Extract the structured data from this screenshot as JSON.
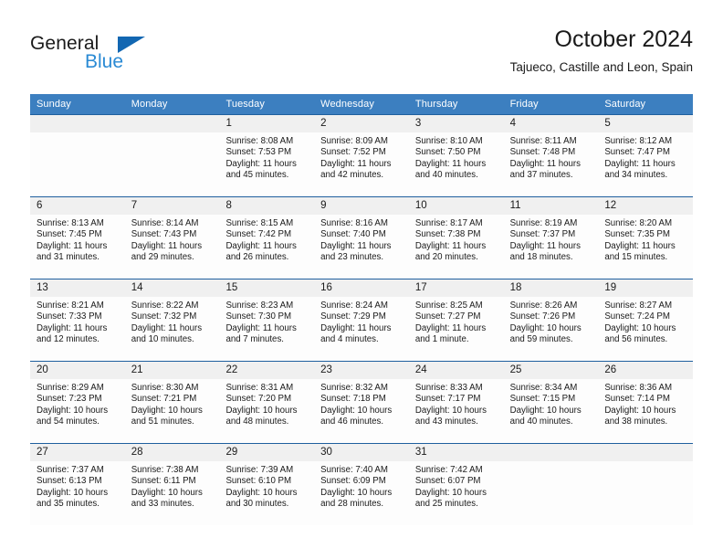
{
  "brand": {
    "name_part1": "General",
    "name_part2": "Blue",
    "accent_color": "#2a8ad4",
    "triangle_color": "#1267b2"
  },
  "header": {
    "title": "October 2024",
    "subtitle": "Tajueco, Castille and Leon, Spain"
  },
  "calendar": {
    "header_bg": "#3c7fc0",
    "header_text_color": "#ffffff",
    "daynum_bg": "#f0f0f0",
    "separator_color": "#1f5f9e",
    "weekdays": [
      "Sunday",
      "Monday",
      "Tuesday",
      "Wednesday",
      "Thursday",
      "Friday",
      "Saturday"
    ],
    "weeks": [
      [
        {
          "day": "",
          "sunrise": "",
          "sunset": "",
          "daylight1": "",
          "daylight2": ""
        },
        {
          "day": "",
          "sunrise": "",
          "sunset": "",
          "daylight1": "",
          "daylight2": ""
        },
        {
          "day": "1",
          "sunrise": "Sunrise: 8:08 AM",
          "sunset": "Sunset: 7:53 PM",
          "daylight1": "Daylight: 11 hours",
          "daylight2": "and 45 minutes."
        },
        {
          "day": "2",
          "sunrise": "Sunrise: 8:09 AM",
          "sunset": "Sunset: 7:52 PM",
          "daylight1": "Daylight: 11 hours",
          "daylight2": "and 42 minutes."
        },
        {
          "day": "3",
          "sunrise": "Sunrise: 8:10 AM",
          "sunset": "Sunset: 7:50 PM",
          "daylight1": "Daylight: 11 hours",
          "daylight2": "and 40 minutes."
        },
        {
          "day": "4",
          "sunrise": "Sunrise: 8:11 AM",
          "sunset": "Sunset: 7:48 PM",
          "daylight1": "Daylight: 11 hours",
          "daylight2": "and 37 minutes."
        },
        {
          "day": "5",
          "sunrise": "Sunrise: 8:12 AM",
          "sunset": "Sunset: 7:47 PM",
          "daylight1": "Daylight: 11 hours",
          "daylight2": "and 34 minutes."
        }
      ],
      [
        {
          "day": "6",
          "sunrise": "Sunrise: 8:13 AM",
          "sunset": "Sunset: 7:45 PM",
          "daylight1": "Daylight: 11 hours",
          "daylight2": "and 31 minutes."
        },
        {
          "day": "7",
          "sunrise": "Sunrise: 8:14 AM",
          "sunset": "Sunset: 7:43 PM",
          "daylight1": "Daylight: 11 hours",
          "daylight2": "and 29 minutes."
        },
        {
          "day": "8",
          "sunrise": "Sunrise: 8:15 AM",
          "sunset": "Sunset: 7:42 PM",
          "daylight1": "Daylight: 11 hours",
          "daylight2": "and 26 minutes."
        },
        {
          "day": "9",
          "sunrise": "Sunrise: 8:16 AM",
          "sunset": "Sunset: 7:40 PM",
          "daylight1": "Daylight: 11 hours",
          "daylight2": "and 23 minutes."
        },
        {
          "day": "10",
          "sunrise": "Sunrise: 8:17 AM",
          "sunset": "Sunset: 7:38 PM",
          "daylight1": "Daylight: 11 hours",
          "daylight2": "and 20 minutes."
        },
        {
          "day": "11",
          "sunrise": "Sunrise: 8:19 AM",
          "sunset": "Sunset: 7:37 PM",
          "daylight1": "Daylight: 11 hours",
          "daylight2": "and 18 minutes."
        },
        {
          "day": "12",
          "sunrise": "Sunrise: 8:20 AM",
          "sunset": "Sunset: 7:35 PM",
          "daylight1": "Daylight: 11 hours",
          "daylight2": "and 15 minutes."
        }
      ],
      [
        {
          "day": "13",
          "sunrise": "Sunrise: 8:21 AM",
          "sunset": "Sunset: 7:33 PM",
          "daylight1": "Daylight: 11 hours",
          "daylight2": "and 12 minutes."
        },
        {
          "day": "14",
          "sunrise": "Sunrise: 8:22 AM",
          "sunset": "Sunset: 7:32 PM",
          "daylight1": "Daylight: 11 hours",
          "daylight2": "and 10 minutes."
        },
        {
          "day": "15",
          "sunrise": "Sunrise: 8:23 AM",
          "sunset": "Sunset: 7:30 PM",
          "daylight1": "Daylight: 11 hours",
          "daylight2": "and 7 minutes."
        },
        {
          "day": "16",
          "sunrise": "Sunrise: 8:24 AM",
          "sunset": "Sunset: 7:29 PM",
          "daylight1": "Daylight: 11 hours",
          "daylight2": "and 4 minutes."
        },
        {
          "day": "17",
          "sunrise": "Sunrise: 8:25 AM",
          "sunset": "Sunset: 7:27 PM",
          "daylight1": "Daylight: 11 hours",
          "daylight2": "and 1 minute."
        },
        {
          "day": "18",
          "sunrise": "Sunrise: 8:26 AM",
          "sunset": "Sunset: 7:26 PM",
          "daylight1": "Daylight: 10 hours",
          "daylight2": "and 59 minutes."
        },
        {
          "day": "19",
          "sunrise": "Sunrise: 8:27 AM",
          "sunset": "Sunset: 7:24 PM",
          "daylight1": "Daylight: 10 hours",
          "daylight2": "and 56 minutes."
        }
      ],
      [
        {
          "day": "20",
          "sunrise": "Sunrise: 8:29 AM",
          "sunset": "Sunset: 7:23 PM",
          "daylight1": "Daylight: 10 hours",
          "daylight2": "and 54 minutes."
        },
        {
          "day": "21",
          "sunrise": "Sunrise: 8:30 AM",
          "sunset": "Sunset: 7:21 PM",
          "daylight1": "Daylight: 10 hours",
          "daylight2": "and 51 minutes."
        },
        {
          "day": "22",
          "sunrise": "Sunrise: 8:31 AM",
          "sunset": "Sunset: 7:20 PM",
          "daylight1": "Daylight: 10 hours",
          "daylight2": "and 48 minutes."
        },
        {
          "day": "23",
          "sunrise": "Sunrise: 8:32 AM",
          "sunset": "Sunset: 7:18 PM",
          "daylight1": "Daylight: 10 hours",
          "daylight2": "and 46 minutes."
        },
        {
          "day": "24",
          "sunrise": "Sunrise: 8:33 AM",
          "sunset": "Sunset: 7:17 PM",
          "daylight1": "Daylight: 10 hours",
          "daylight2": "and 43 minutes."
        },
        {
          "day": "25",
          "sunrise": "Sunrise: 8:34 AM",
          "sunset": "Sunset: 7:15 PM",
          "daylight1": "Daylight: 10 hours",
          "daylight2": "and 40 minutes."
        },
        {
          "day": "26",
          "sunrise": "Sunrise: 8:36 AM",
          "sunset": "Sunset: 7:14 PM",
          "daylight1": "Daylight: 10 hours",
          "daylight2": "and 38 minutes."
        }
      ],
      [
        {
          "day": "27",
          "sunrise": "Sunrise: 7:37 AM",
          "sunset": "Sunset: 6:13 PM",
          "daylight1": "Daylight: 10 hours",
          "daylight2": "and 35 minutes."
        },
        {
          "day": "28",
          "sunrise": "Sunrise: 7:38 AM",
          "sunset": "Sunset: 6:11 PM",
          "daylight1": "Daylight: 10 hours",
          "daylight2": "and 33 minutes."
        },
        {
          "day": "29",
          "sunrise": "Sunrise: 7:39 AM",
          "sunset": "Sunset: 6:10 PM",
          "daylight1": "Daylight: 10 hours",
          "daylight2": "and 30 minutes."
        },
        {
          "day": "30",
          "sunrise": "Sunrise: 7:40 AM",
          "sunset": "Sunset: 6:09 PM",
          "daylight1": "Daylight: 10 hours",
          "daylight2": "and 28 minutes."
        },
        {
          "day": "31",
          "sunrise": "Sunrise: 7:42 AM",
          "sunset": "Sunset: 6:07 PM",
          "daylight1": "Daylight: 10 hours",
          "daylight2": "and 25 minutes."
        },
        {
          "day": "",
          "sunrise": "",
          "sunset": "",
          "daylight1": "",
          "daylight2": ""
        },
        {
          "day": "",
          "sunrise": "",
          "sunset": "",
          "daylight1": "",
          "daylight2": ""
        }
      ]
    ]
  }
}
